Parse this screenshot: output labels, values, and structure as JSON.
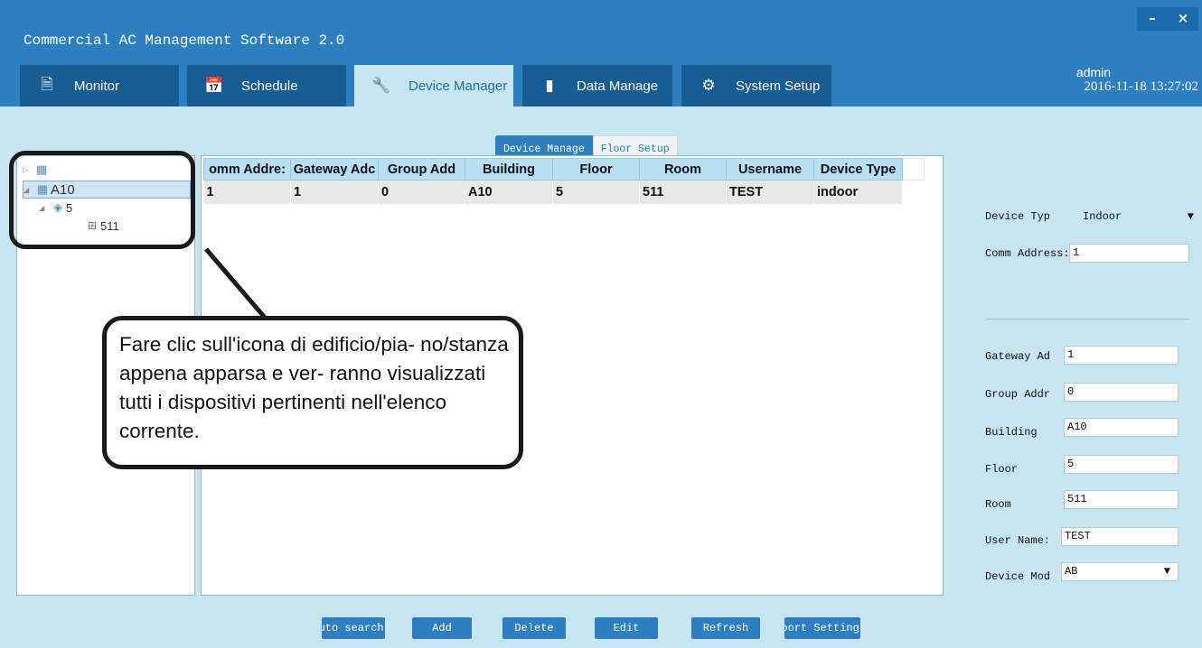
{
  "app": {
    "title": "Commercial AC Management Software 2.0",
    "minimize": "–",
    "close": "×",
    "user": "admin",
    "datetime": "2016-11-18 13:27:02"
  },
  "tabs": [
    {
      "label": "Monitor",
      "icon": "document-icon",
      "glyph": "🗎"
    },
    {
      "label": "Schedule",
      "icon": "calendar-icon",
      "glyph": "📅"
    },
    {
      "label": "Device Manager",
      "icon": "wrench-icon",
      "glyph": "🔧"
    },
    {
      "label": "Data Manage",
      "icon": "bar-chart-icon",
      "glyph": "▮"
    },
    {
      "label": "System Setup",
      "icon": "gear-icon",
      "glyph": "⚙"
    }
  ],
  "subtabs": [
    "Device Manage",
    "Floor Setup"
  ],
  "tree": {
    "root_glyph": "▦",
    "building": "A10",
    "floor": "5",
    "room": "511"
  },
  "table": {
    "headers": [
      "omm Addre:",
      "Gateway Adc",
      "Group Add",
      "Building",
      "Floor",
      "Room",
      "Username",
      "Device Type"
    ],
    "rows": [
      [
        "1",
        "1",
        "0",
        "A10",
        "5",
        "511",
        "TEST",
        "indoor"
      ]
    ]
  },
  "form": {
    "device_type_label": "Device Typ",
    "device_type_value": "Indoor",
    "comm_address_label": "Comm Address:",
    "comm_address_value": "1",
    "gateway_label": "Gateway Ad",
    "gateway_value": "1",
    "group_label": "Group Addr",
    "group_value": "0",
    "building_label": "Building",
    "building_value": "A10",
    "floor_label": "Floor",
    "floor_value": "5",
    "room_label": "Room",
    "room_value": "511",
    "username_label": "User Name:",
    "username_value": "TEST",
    "device_mode_label": "Device Mod",
    "device_mode_value": "AB",
    "dropdown_arrow": "▼"
  },
  "buttons": {
    "auto_search": "Auto search",
    "add": "Add",
    "delete": "Delete",
    "edit": "Edit",
    "refresh": "Refresh",
    "export_settings": "Export Settings"
  },
  "callout": "Fare clic sull'icona di edificio/pia- no/stanza appena apparsa e ver- ranno visualizzati tutti i dispositivi pertinenti nell'elenco corrente."
}
